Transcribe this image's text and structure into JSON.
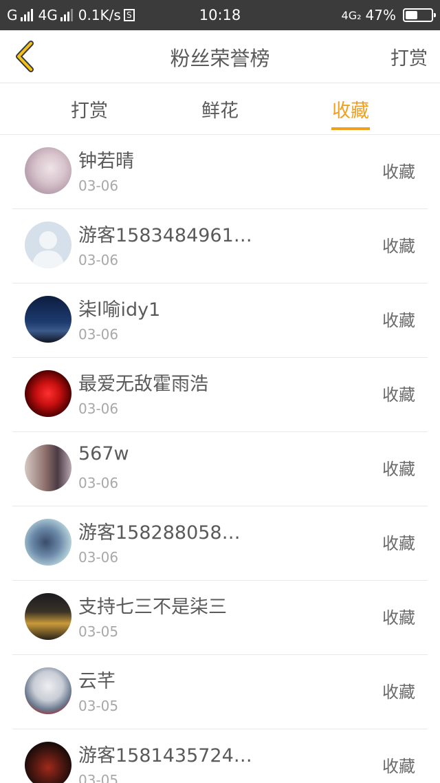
{
  "status_bar": {
    "carrier": "G",
    "network": "4G",
    "speed": "0.1K/s",
    "s_icon": "S",
    "time": "10:18",
    "net_right": "4G₂",
    "battery_text": "47%",
    "battery_level": 0.47
  },
  "nav": {
    "back_icon": "chevron-left",
    "title": "粉丝荣誉榜",
    "action": "打赏",
    "accent": "#f0a01e"
  },
  "tabs": [
    {
      "label": "打赏",
      "active": false
    },
    {
      "label": "鲜花",
      "active": false
    },
    {
      "label": "收藏",
      "active": true
    }
  ],
  "rows": [
    {
      "name": "钟若晴",
      "date": "03-06",
      "type": "收藏",
      "avatar": "anime-girl-light"
    },
    {
      "name": "游客1583484961…",
      "date": "03-06",
      "type": "收藏",
      "avatar": "default-user"
    },
    {
      "name": "柒l喻idy1",
      "date": "03-06",
      "type": "收藏",
      "avatar": "night-sky"
    },
    {
      "name": "最爱无敌霍雨浩",
      "date": "03-06",
      "type": "收藏",
      "avatar": "red-flower"
    },
    {
      "name": "567w",
      "date": "03-06",
      "type": "收藏",
      "avatar": "anime-couple"
    },
    {
      "name": "游客158288058…",
      "date": "03-06",
      "type": "收藏",
      "avatar": "anime-hug"
    },
    {
      "name": "支持七三不是柒三",
      "date": "03-05",
      "type": "收藏",
      "avatar": "sunset-scene"
    },
    {
      "name": "云芊",
      "date": "03-05",
      "type": "收藏",
      "avatar": "white-hair-girl"
    },
    {
      "name": "游客1581435724…",
      "date": "03-05",
      "type": "收藏",
      "avatar": "dark-character"
    }
  ]
}
